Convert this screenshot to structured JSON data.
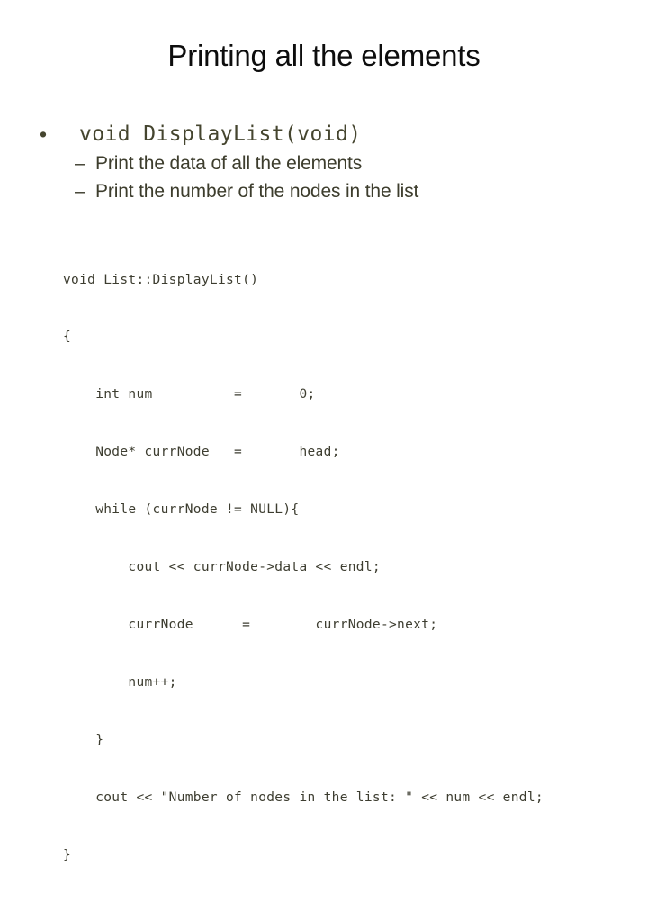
{
  "slide": {
    "title": "Printing all the elements",
    "background_color": "#ffffff",
    "title_color": "#0d0d0d",
    "bullet_color": "#45452f",
    "subbullet_color": "#3d3d2d",
    "code_color": "#3d3d30"
  },
  "outline": {
    "bullet_glyph": "•",
    "dash_glyph": "–",
    "level1": [
      {
        "text": "void DisplayList(void)"
      }
    ],
    "level2": [
      {
        "text": "Print the data of all the elements"
      },
      {
        "text": "Print the number of the nodes in the list"
      }
    ]
  },
  "code": {
    "language": "cpp",
    "lines": [
      "void List::DisplayList()",
      "{",
      "    int num          =       0;",
      "    Node* currNode   =       head;",
      "    while (currNode != NULL){",
      "        cout << currNode->data << endl;",
      "        currNode      =        currNode->next;",
      "        num++;",
      "    }",
      "    cout << \"Number of nodes in the list: \" << num << endl;",
      "}"
    ]
  }
}
